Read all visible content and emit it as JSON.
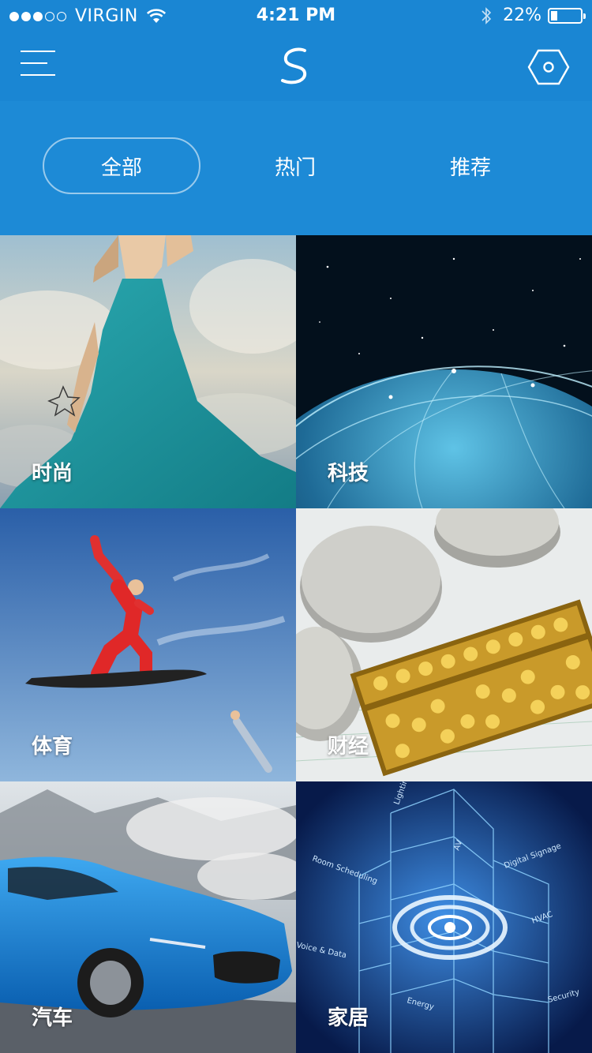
{
  "status": {
    "carrier": "VIRGIN",
    "time": "4:21 PM",
    "battery_pct": "22%",
    "battery_level": 0.22,
    "signal_bars": 3,
    "signal_total": 5
  },
  "nav": {
    "menu_icon": "hamburger-menu-icon",
    "logo_icon": "s-logo-icon",
    "settings_icon": "hexagon-settings-icon"
  },
  "tabs": [
    {
      "label": "全部",
      "active": true
    },
    {
      "label": "热门",
      "active": false
    },
    {
      "label": "推荐",
      "active": false
    }
  ],
  "categories": [
    {
      "label": "时尚"
    },
    {
      "label": "科技"
    },
    {
      "label": "体育"
    },
    {
      "label": "财经"
    },
    {
      "label": "汽车"
    },
    {
      "label": "家居"
    }
  ],
  "art_text": {
    "building": [
      "Lighting",
      "AV",
      "Room Scheduling",
      "Digital Signage",
      "Voice & Data",
      "HVAC",
      "Energy",
      "Security"
    ]
  },
  "colors": {
    "header": "#1d8ad6",
    "topbar": "#1a86d3"
  }
}
